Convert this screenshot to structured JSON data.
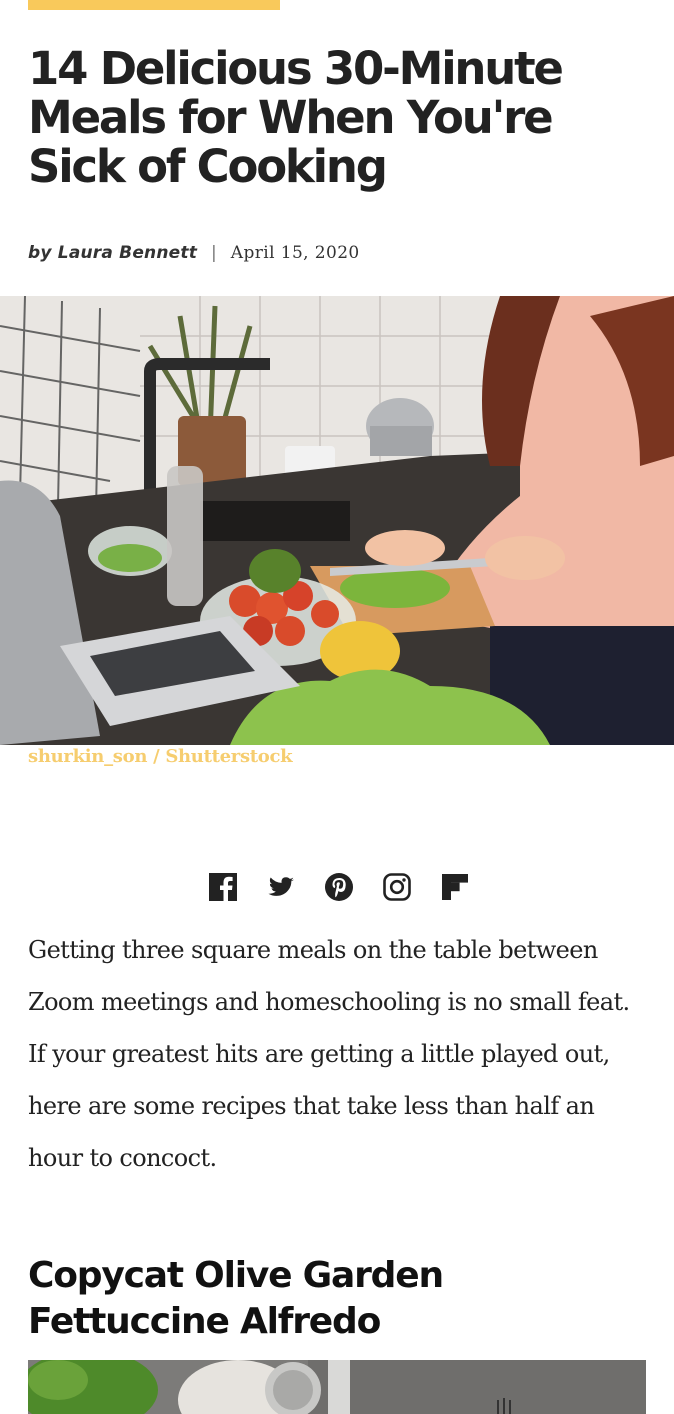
{
  "article": {
    "title": "14 Delicious 30-Minute Meals for When You're Sick of Cooking",
    "byline_prefix": "by",
    "author": "Laura Bennett",
    "separator": "|",
    "date": "April 15, 2020",
    "image_credit": "shurkin_son / Shutterstock",
    "intro": "Getting three square meals on the table between Zoom meetings and homeschooling is no small feat. If your greatest hits are getting a little played out, here are some recipes that take less than half an hour to concoct.",
    "section_heading": "Copycat Olive Garden Fettuccine Alfredo"
  },
  "share_icons": [
    "facebook-icon",
    "twitter-icon",
    "pinterest-icon",
    "instagram-icon",
    "flipboard-icon"
  ],
  "colors": {
    "accent": "#f9c95b",
    "credit": "#f6cd6f",
    "text": "#222222"
  }
}
